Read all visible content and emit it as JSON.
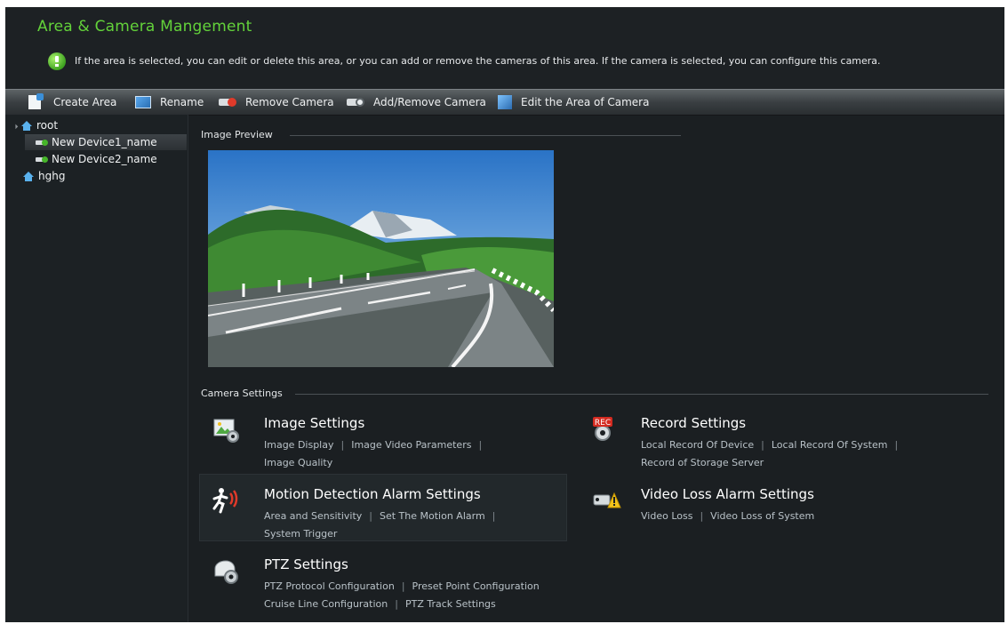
{
  "header": {
    "title": "Area & Camera Mangement",
    "tip": "If the area is selected, you can edit or delete this area, or you can add or remove the cameras of this area. If the camera is selected, you can configure this camera."
  },
  "toolbar": {
    "create_area": "Create Area",
    "rename": "Rename",
    "remove_camera": "Remove Camera",
    "add_remove_camera": "Add/Remove Camera",
    "edit_area_of_camera": "Edit the Area of Camera"
  },
  "tree": {
    "root": "root",
    "devices": [
      "New Device1_name",
      "New Device2_name"
    ],
    "area2": "hghg"
  },
  "main": {
    "image_preview_label": "Image Preview",
    "camera_settings_label": "Camera Settings"
  },
  "settings": {
    "image": {
      "title": "Image Settings",
      "links": [
        "Image Display",
        "Image Video Parameters",
        "Image Quality"
      ]
    },
    "record": {
      "title": "Record Settings",
      "links": [
        "Local Record Of Device",
        "Local Record Of System",
        "Record of Storage Server"
      ]
    },
    "motion": {
      "title": "Motion Detection Alarm Settings",
      "links": [
        "Area and Sensitivity",
        "Set The Motion Alarm",
        "System Trigger"
      ]
    },
    "videoloss": {
      "title": "Video Loss Alarm Settings",
      "links": [
        "Video Loss",
        "Video Loss of System"
      ]
    },
    "ptz": {
      "title": "PTZ Settings",
      "links": [
        "PTZ Protocol Configuration",
        "Preset Point Configuration",
        "Cruise Line Configuration",
        "PTZ Track Settings"
      ]
    }
  },
  "icons": {
    "rec_badge": "REC"
  },
  "colors": {
    "title_green": "#63d23a",
    "link_gray": "#b9c2c8",
    "tree_blue": "#5ab2ee"
  }
}
